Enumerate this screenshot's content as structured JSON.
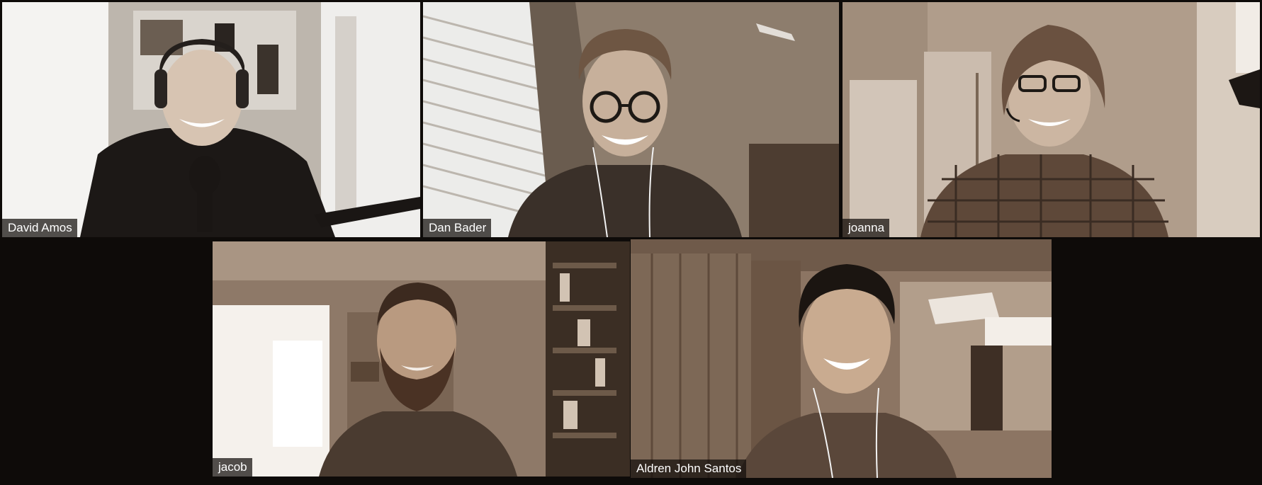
{
  "meeting": {
    "view": "gallery",
    "active_speaker": "Aldren John Santos"
  },
  "participants": [
    {
      "name": "David Amos"
    },
    {
      "name": "Dan Bader"
    },
    {
      "name": "joanna"
    },
    {
      "name": "jacob"
    },
    {
      "name": "Aldren John Santos"
    }
  ],
  "colors": {
    "background": "#0e0b09",
    "active_border": "#cfc6ba",
    "name_tag_bg": "#120e0b",
    "name_tag_text": "#ffffff"
  }
}
